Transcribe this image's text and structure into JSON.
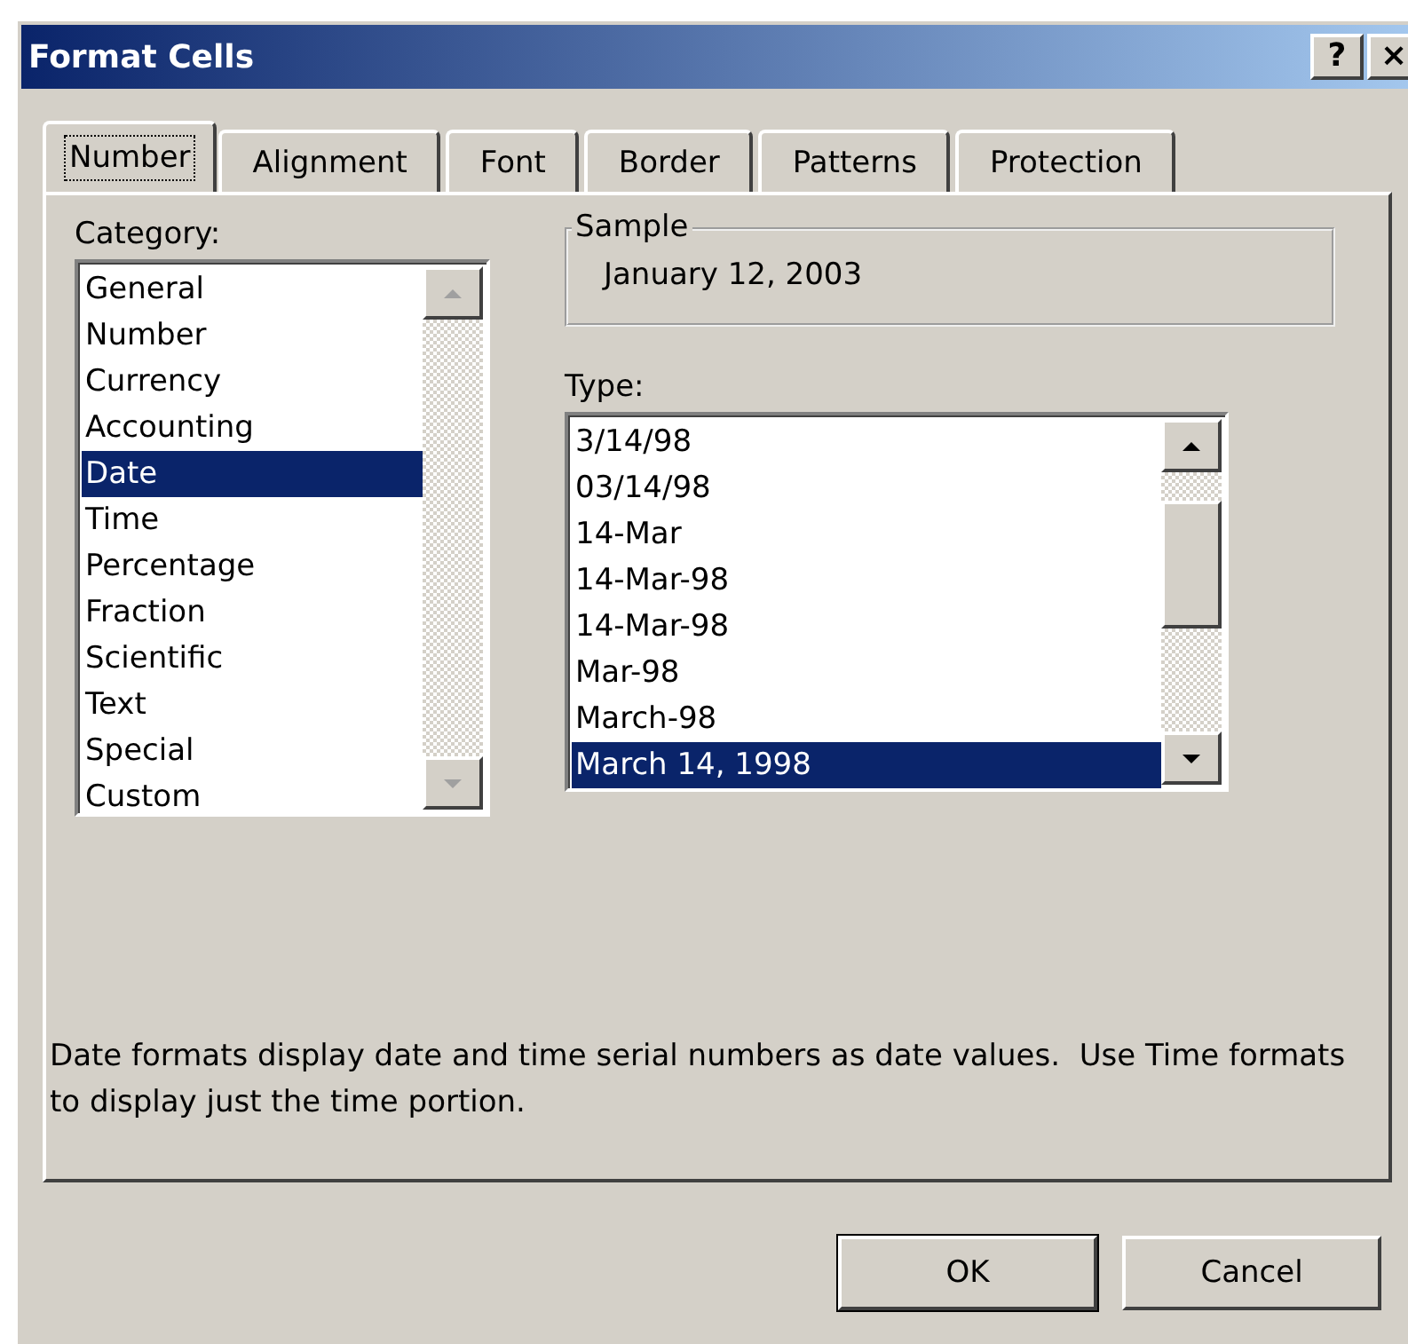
{
  "window": {
    "title": "Format Cells",
    "title_buttons": [
      "?",
      "×"
    ]
  },
  "tabs": [
    {
      "label": "Number",
      "selected": true
    },
    {
      "label": "Alignment",
      "selected": false
    },
    {
      "label": "Font",
      "selected": false
    },
    {
      "label": "Border",
      "selected": false
    },
    {
      "label": "Patterns",
      "selected": false
    },
    {
      "label": "Protection",
      "selected": false
    }
  ],
  "category": {
    "label": "Category:",
    "items": [
      {
        "label": "General",
        "selected": false
      },
      {
        "label": "Number",
        "selected": false
      },
      {
        "label": "Currency",
        "selected": false
      },
      {
        "label": "Accounting",
        "selected": false
      },
      {
        "label": "Date",
        "selected": true
      },
      {
        "label": "Time",
        "selected": false
      },
      {
        "label": "Percentage",
        "selected": false
      },
      {
        "label": "Fraction",
        "selected": false
      },
      {
        "label": "Scientific",
        "selected": false
      },
      {
        "label": "Text",
        "selected": false
      },
      {
        "label": "Special",
        "selected": false
      },
      {
        "label": "Custom",
        "selected": false
      }
    ]
  },
  "sample": {
    "label": "Sample",
    "value": "January 12, 2003"
  },
  "type": {
    "label": "Type:",
    "items": [
      {
        "label": "3/14/98",
        "selected": false
      },
      {
        "label": "03/14/98",
        "selected": false
      },
      {
        "label": "14-Mar",
        "selected": false
      },
      {
        "label": "14-Mar-98",
        "selected": false
      },
      {
        "label": "14-Mar-98",
        "selected": false
      },
      {
        "label": "Mar-98",
        "selected": false
      },
      {
        "label": "March-98",
        "selected": false
      },
      {
        "label": "March 14, 1998",
        "selected": true
      }
    ]
  },
  "description": "Date formats display date and time serial numbers as date values.  Use Time formats to display just the time portion.",
  "buttons": [
    {
      "label": "OK",
      "default": true
    },
    {
      "label": "Cancel",
      "default": false
    }
  ]
}
